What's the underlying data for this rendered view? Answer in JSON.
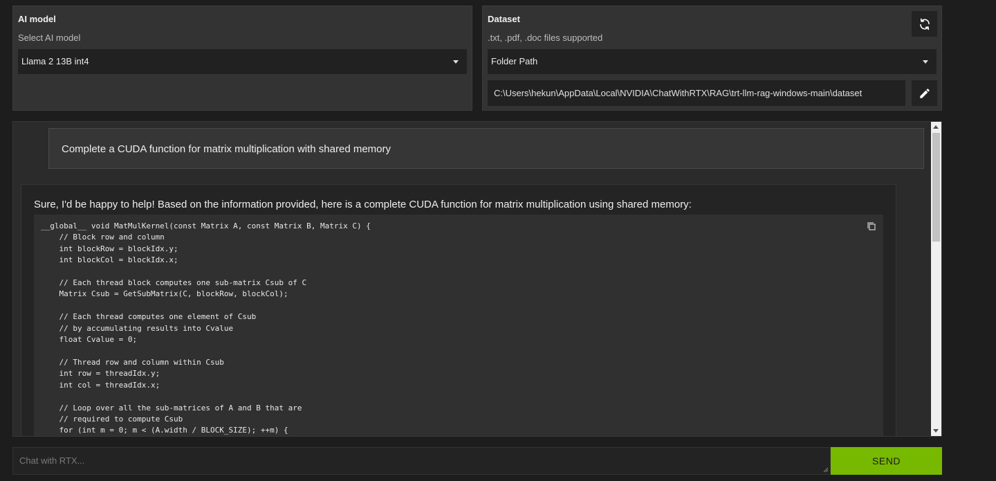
{
  "ai_model": {
    "title": "AI model",
    "subtitle": "Select AI model",
    "selected": "Llama 2 13B int4"
  },
  "dataset": {
    "title": "Dataset",
    "subtitle": ".txt, .pdf, .doc files supported",
    "selected": "Folder Path",
    "path": "C:\\Users\\hekun\\AppData\\Local\\NVIDIA\\ChatWithRTX\\RAG\\trt-llm-rag-windows-main\\dataset"
  },
  "icons": {
    "refresh": "refresh-icon",
    "edit": "pencil-icon",
    "copy": "copy-icon",
    "dropdown": "chevron-down-icon"
  },
  "chat": {
    "user_message": "Complete a CUDA function for matrix multiplication with shared memory",
    "bot_intro": "Sure, I'd be happy to help! Based on the information provided, here is a complete CUDA function for matrix multiplication using shared memory:",
    "code": "__global__ void MatMulKernel(const Matrix A, const Matrix B, Matrix C) {\n    // Block row and column\n    int blockRow = blockIdx.y;\n    int blockCol = blockIdx.x;\n\n    // Each thread block computes one sub-matrix Csub of C\n    Matrix Csub = GetSubMatrix(C, blockRow, blockCol);\n\n    // Each thread computes one element of Csub\n    // by accumulating results into Cvalue\n    float Cvalue = 0;\n\n    // Thread row and column within Csub\n    int row = threadIdx.y;\n    int col = threadIdx.x;\n\n    // Loop over all the sub-matrices of A and B that are\n    // required to compute Csub\n    for (int m = 0; m < (A.width / BLOCK_SIZE); ++m) {"
  },
  "composer": {
    "placeholder": "Chat with RTX...",
    "send_label": "SEND"
  },
  "colors": {
    "accent": "#76b900",
    "background": "#1d1d1d",
    "panel": "#333333"
  }
}
